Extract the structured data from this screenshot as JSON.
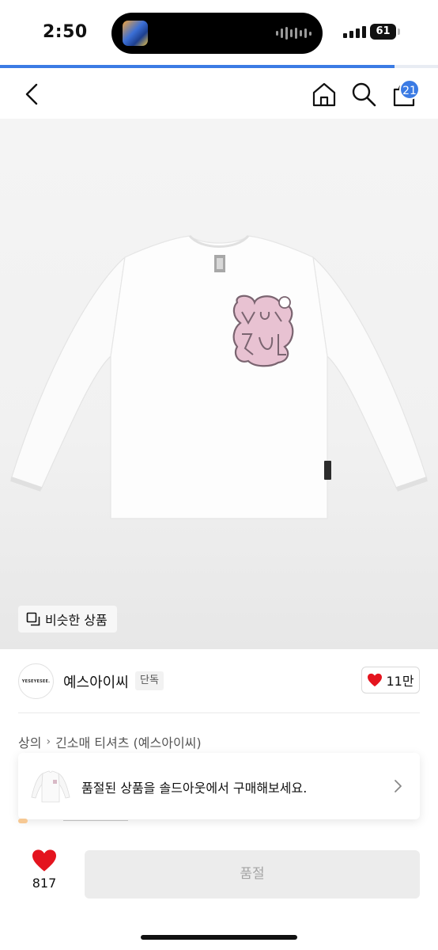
{
  "status_bar": {
    "time": "2:50",
    "battery": "61"
  },
  "navigation": {
    "cart_badge": "21"
  },
  "product": {
    "similar_button_label": "비슷한 상품",
    "seller_name": "예스아이씨",
    "seller_badge": "단독",
    "seller_logo_text": "YESEYESEE.",
    "like_count": "11만",
    "breadcrumb": {
      "category": "상의",
      "subcategory": "긴소매 티셔츠 (예스아이씨)"
    }
  },
  "soldout_banner": {
    "text": "품절된 상품을 솔드아웃에서 구매해보세요."
  },
  "bottom_bar": {
    "wish_count": "817",
    "buy_button_label": "품절"
  },
  "colors": {
    "accent": "#3b7be4",
    "heart": "#e4141e",
    "graphic_pink": "#e2b6c8"
  },
  "icons": [
    "back-icon",
    "home-icon",
    "search-icon",
    "cart-icon",
    "copy-icon",
    "heart-icon",
    "chevron-right-icon"
  ]
}
